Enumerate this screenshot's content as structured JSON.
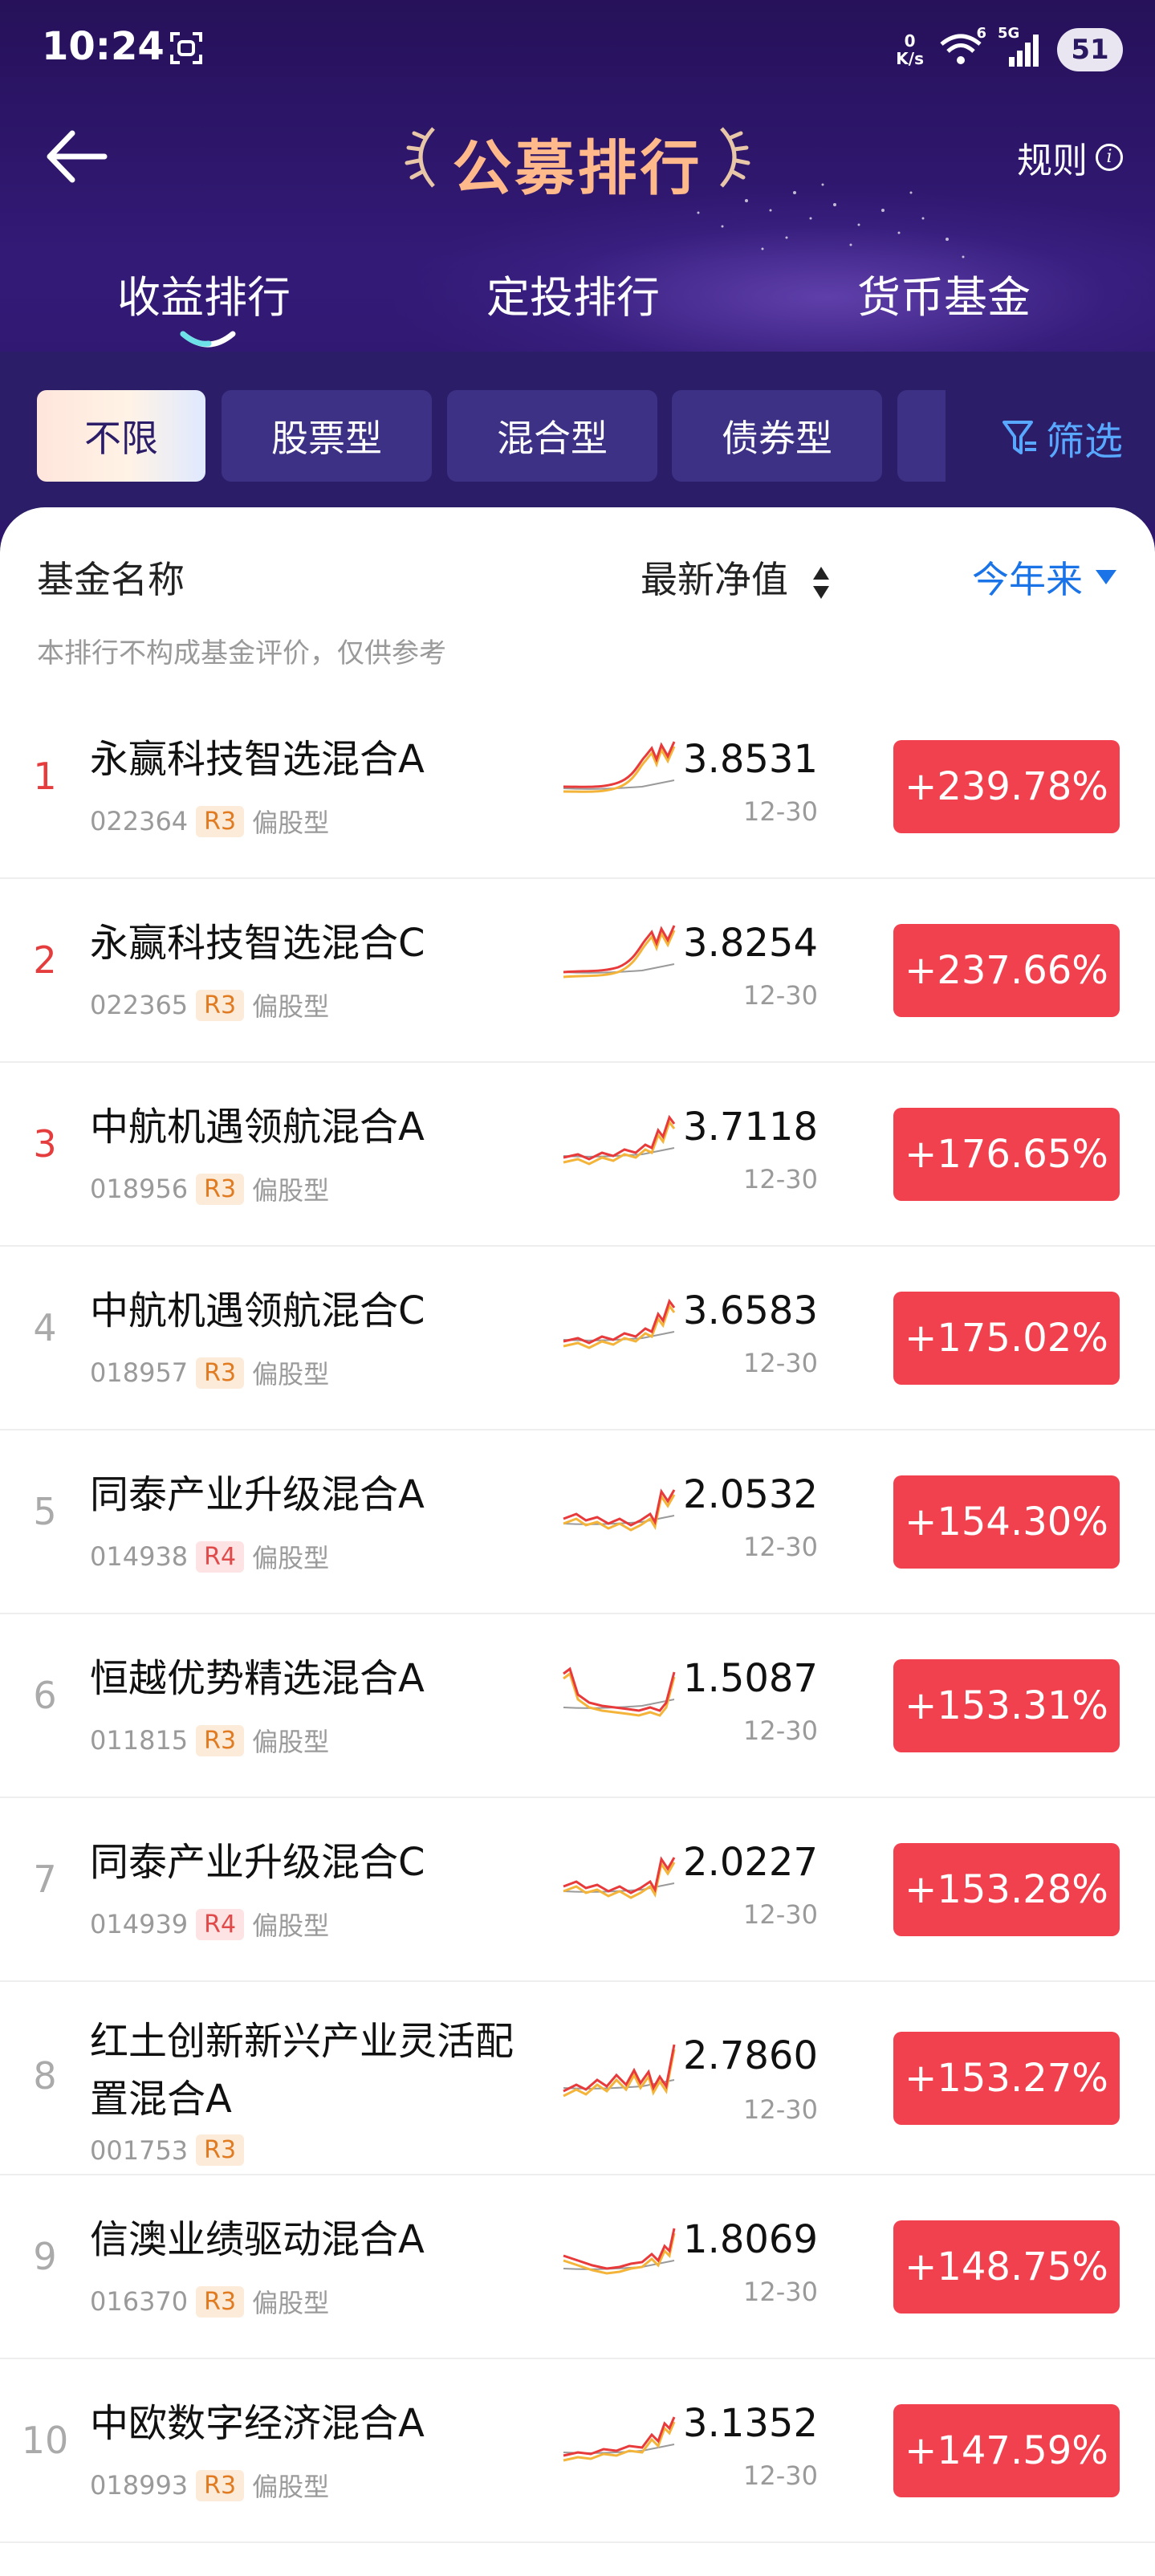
{
  "status_bar": {
    "time": "10:24",
    "net_speed_value": "0",
    "net_speed_unit": "K/s",
    "wifi_badge": "6",
    "signal_label": "5G",
    "battery": "51"
  },
  "nav": {
    "title": "公募排行",
    "rules_label": "规则"
  },
  "main_tabs": [
    {
      "label": "收益排行",
      "active": true
    },
    {
      "label": "定投排行",
      "active": false
    },
    {
      "label": "货币基金",
      "active": false
    }
  ],
  "filter_chips": [
    {
      "label": "不限",
      "active": true
    },
    {
      "label": "股票型",
      "active": false
    },
    {
      "label": "混合型",
      "active": false
    },
    {
      "label": "债券型",
      "active": false
    }
  ],
  "filter_button_label": "筛选",
  "table": {
    "col_name": "基金名称",
    "col_nav": "最新净值",
    "col_period": "今年来",
    "disclaimer": "本排行不构成基金评价，仅供参考"
  },
  "funds": [
    {
      "rank": "1",
      "name": "永赢科技智选混合A",
      "code": "022364",
      "risk": "R3",
      "type": "偏股型",
      "nav": "3.8531",
      "date": "12-30",
      "gain": "+239.78%"
    },
    {
      "rank": "2",
      "name": "永赢科技智选混合C",
      "code": "022365",
      "risk": "R3",
      "type": "偏股型",
      "nav": "3.8254",
      "date": "12-30",
      "gain": "+237.66%"
    },
    {
      "rank": "3",
      "name": "中航机遇领航混合A",
      "code": "018956",
      "risk": "R3",
      "type": "偏股型",
      "nav": "3.7118",
      "date": "12-30",
      "gain": "+176.65%"
    },
    {
      "rank": "4",
      "name": "中航机遇领航混合C",
      "code": "018957",
      "risk": "R3",
      "type": "偏股型",
      "nav": "3.6583",
      "date": "12-30",
      "gain": "+175.02%"
    },
    {
      "rank": "5",
      "name": "同泰产业升级混合A",
      "code": "014938",
      "risk": "R4",
      "type": "偏股型",
      "nav": "2.0532",
      "date": "12-30",
      "gain": "+154.30%"
    },
    {
      "rank": "6",
      "name": "恒越优势精选混合A",
      "code": "011815",
      "risk": "R3",
      "type": "偏股型",
      "nav": "1.5087",
      "date": "12-30",
      "gain": "+153.31%"
    },
    {
      "rank": "7",
      "name": "同泰产业升级混合C",
      "code": "014939",
      "risk": "R4",
      "type": "偏股型",
      "nav": "2.0227",
      "date": "12-30",
      "gain": "+153.28%"
    },
    {
      "rank": "8",
      "name": "红土创新新兴产业灵活配置混合A",
      "code": "001753",
      "risk": "R3",
      "type": "",
      "nav": "2.7860",
      "date": "12-30",
      "gain": "+153.27%"
    },
    {
      "rank": "9",
      "name": "信澳业绩驱动混合A",
      "code": "016370",
      "risk": "R3",
      "type": "偏股型",
      "nav": "1.8069",
      "date": "12-30",
      "gain": "+148.75%"
    },
    {
      "rank": "10",
      "name": "中欧数字经济混合A",
      "code": "018993",
      "risk": "R3",
      "type": "偏股型",
      "nav": "3.1352",
      "date": "12-30",
      "gain": "+147.59%"
    }
  ],
  "colors": {
    "header_bg": "#2b1869",
    "title_gold": "#ffb98a",
    "gain_red": "#f2414e",
    "rank_top_red": "#e53d3d",
    "link_blue": "#1a74e8",
    "filter_blue": "#58a8ff"
  },
  "icons": {
    "back": "arrow-left-icon",
    "rules": "info-icon",
    "filter": "funnel-icon",
    "sort": "sort-arrows-icon",
    "period_dropdown": "triangle-down-icon",
    "sparkline": "sparkline-chart-icon"
  }
}
